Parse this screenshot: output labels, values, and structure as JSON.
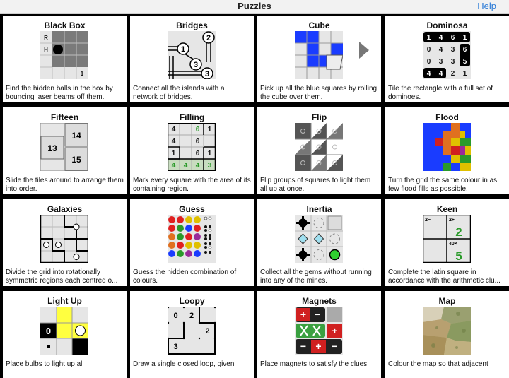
{
  "header": {
    "title": "Puzzles",
    "help_label": "Help"
  },
  "puzzles": [
    {
      "name": "Black Box",
      "desc": "Find the hidden balls in the box by bouncing laser beams off them.",
      "icon": "black-box-icon"
    },
    {
      "name": "Bridges",
      "desc": "Connect all the islands with a network of bridges.",
      "icon": "bridges-icon"
    },
    {
      "name": "Cube",
      "desc": "Pick up all the blue squares by rolling the cube over them.",
      "icon": "cube-icon"
    },
    {
      "name": "Dominosa",
      "desc": "Tile the rectangle with a full set of dominoes.",
      "icon": "dominosa-icon"
    },
    {
      "name": "Fifteen",
      "desc": "Slide the tiles around to arrange them into order.",
      "icon": "fifteen-icon"
    },
    {
      "name": "Filling",
      "desc": "Mark every square with the area of its containing region.",
      "icon": "filling-icon"
    },
    {
      "name": "Flip",
      "desc": "Flip groups of squares to light them all up at once.",
      "icon": "flip-icon"
    },
    {
      "name": "Flood",
      "desc": "Turn the grid the same colour in as few flood fills as possible.",
      "icon": "flood-icon"
    },
    {
      "name": "Galaxies",
      "desc": "Divide the grid into rotationally symmetric regions each centred o...",
      "icon": "galaxies-icon"
    },
    {
      "name": "Guess",
      "desc": "Guess the hidden combination of colours.",
      "icon": "guess-icon"
    },
    {
      "name": "Inertia",
      "desc": "Collect all the gems without running into any of the mines.",
      "icon": "inertia-icon"
    },
    {
      "name": "Keen",
      "desc": "Complete the latin square in accordance with the arithmetic clu...",
      "icon": "keen-icon"
    },
    {
      "name": "Light Up",
      "desc": "Place bulbs to light up all",
      "icon": "light-up-icon"
    },
    {
      "name": "Loopy",
      "desc": "Draw a single closed loop, given",
      "icon": "loopy-icon"
    },
    {
      "name": "Magnets",
      "desc": "Place magnets to satisfy the clues",
      "icon": "magnets-icon"
    },
    {
      "name": "Map",
      "desc": "Colour the map so that adjacent",
      "icon": "map-icon"
    }
  ],
  "icon_text": {
    "blackbox": [
      "R",
      "H",
      "1"
    ],
    "bridges": [
      "2",
      "1",
      "3",
      "3"
    ],
    "dominosa": [
      [
        "1",
        "4",
        "6",
        "1"
      ],
      [
        "0",
        "4",
        "3",
        "6"
      ],
      [
        "0",
        "3",
        "3",
        "5"
      ],
      [
        "4",
        "4",
        "2",
        "1"
      ]
    ],
    "fifteen": [
      "14",
      "13",
      "15"
    ],
    "filling": [
      [
        "4",
        "",
        "6",
        "1"
      ],
      [
        "4",
        "",
        "6",
        ""
      ],
      [
        "1",
        "",
        "6",
        "1"
      ],
      [
        "4",
        "4",
        "4",
        "3"
      ]
    ],
    "keen": [
      "2−",
      "2÷",
      "2",
      "40×",
      "5"
    ],
    "lightup": [
      "0"
    ],
    "loopy": [
      "0",
      "2",
      "2",
      "3"
    ]
  },
  "colors": {
    "help": "#2a7ad6",
    "accent_blue": "#1a3cff",
    "green_num": "#2a9a2a"
  }
}
